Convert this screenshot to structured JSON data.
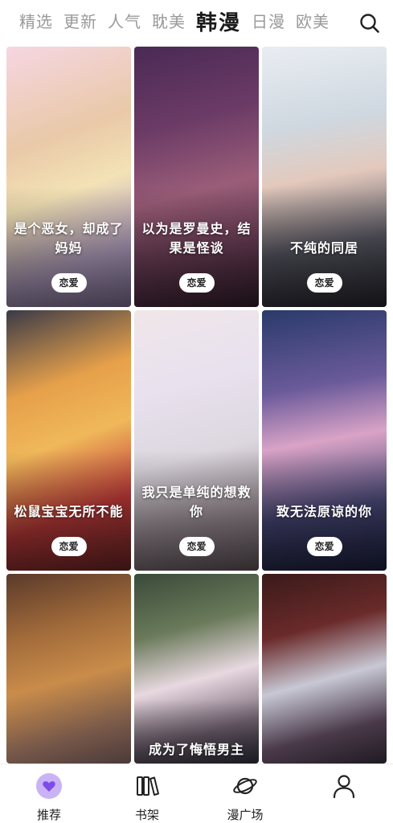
{
  "tabs": [
    {
      "label": "精选",
      "active": false
    },
    {
      "label": "更新",
      "active": false
    },
    {
      "label": "人气",
      "active": false
    },
    {
      "label": "耽美",
      "active": false
    },
    {
      "label": "韩漫",
      "active": true
    },
    {
      "label": "日漫",
      "active": false
    },
    {
      "label": "欧美",
      "active": false
    }
  ],
  "cards": [
    {
      "title": "是个恶女，却成了妈妈",
      "tag": "恋爱"
    },
    {
      "title": "以为是罗曼史，结果是怪谈",
      "tag": "恋爱"
    },
    {
      "title": "不纯的同居",
      "tag": "恋爱"
    },
    {
      "title": "松鼠宝宝无所不能",
      "tag": "恋爱"
    },
    {
      "title": "我只是单纯的想救你",
      "tag": "恋爱"
    },
    {
      "title": "致无法原谅的你",
      "tag": "恋爱"
    },
    {
      "title": "",
      "tag": ""
    },
    {
      "title": "成为了悔悟男主",
      "tag": ""
    },
    {
      "title": "",
      "tag": ""
    }
  ],
  "bottom_nav": [
    {
      "label": "推荐",
      "icon": "heart-icon",
      "active": true
    },
    {
      "label": "书架",
      "icon": "bookshelf-icon",
      "active": false
    },
    {
      "label": "漫广场",
      "icon": "planet-icon",
      "active": false
    },
    {
      "label": "",
      "icon": "profile-icon",
      "active": false
    }
  ],
  "colors": {
    "accent": "#8a5cf6",
    "active_tab": "#1a1a1a",
    "inactive_tab": "#9a9a9a"
  }
}
